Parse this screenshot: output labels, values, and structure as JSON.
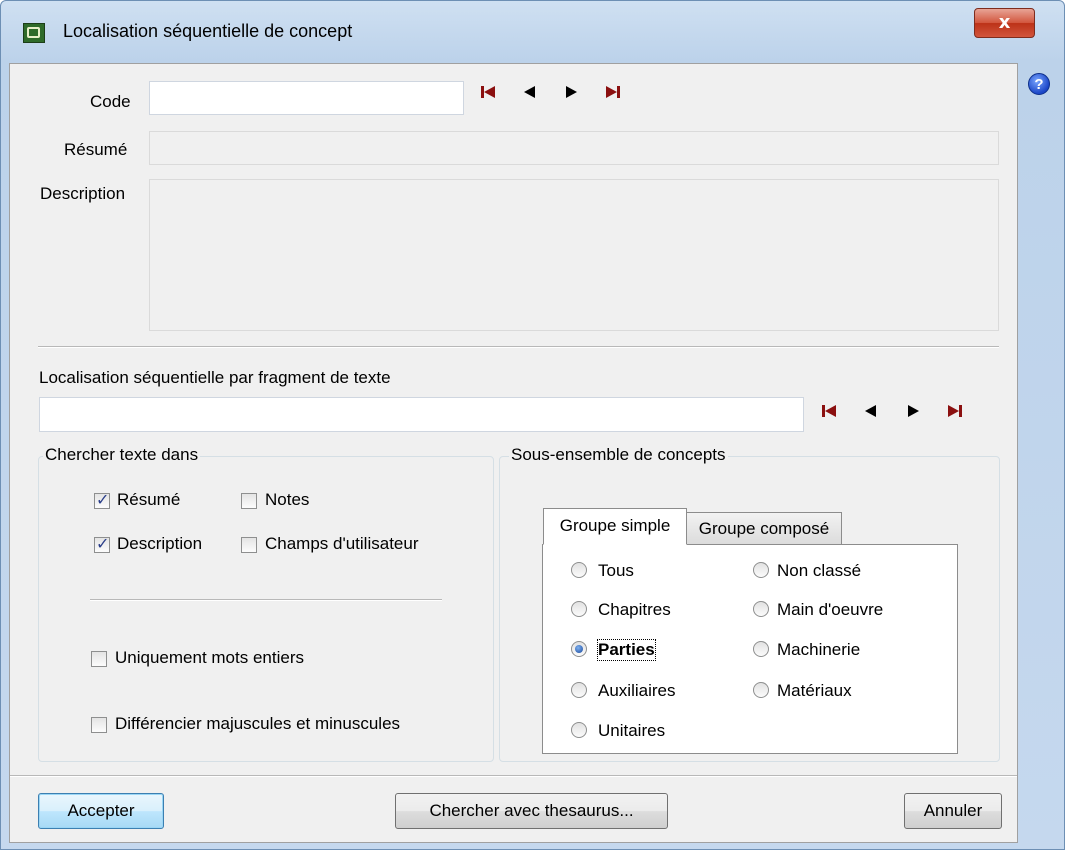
{
  "window": {
    "title": "Localisation séquentielle de concept",
    "close_label": "x",
    "help_label": "?"
  },
  "code": {
    "label": "Code",
    "value": ""
  },
  "resume": {
    "label": "Résumé",
    "value": ""
  },
  "description": {
    "label": "Description",
    "value": ""
  },
  "fragment": {
    "label": "Localisation séquentielle par fragment de texte",
    "value": ""
  },
  "search_in": {
    "title": "Chercher texte dans",
    "resume": {
      "label": "Résumé",
      "checked": true
    },
    "notes": {
      "label": "Notes",
      "checked": false
    },
    "description": {
      "label": "Description",
      "checked": true
    },
    "user_fields": {
      "label": "Champs d'utilisateur",
      "checked": false
    },
    "whole_words": {
      "label": "Uniquement mots entiers",
      "checked": false
    },
    "match_case": {
      "label": "Différencier majuscules et minuscules",
      "checked": false
    }
  },
  "subset": {
    "title": "Sous-ensemble de concepts",
    "tabs": [
      "Groupe simple",
      "Groupe composé"
    ],
    "active_tab": "Groupe simple",
    "options": {
      "tous": "Tous",
      "non_classe": "Non classé",
      "chapitres": "Chapitres",
      "main_oeuvre": "Main d'oeuvre",
      "parties": "Parties",
      "machinerie": "Machinerie",
      "auxiliaires": "Auxiliaires",
      "materiaux": "Matériaux",
      "unitaires": "Unitaires"
    },
    "selected": "Parties"
  },
  "buttons": {
    "accept": "Accepter",
    "thesaurus": "Chercher avec thesaurus...",
    "cancel": "Annuler"
  },
  "colors": {
    "nav_first_last": "#8b1010",
    "nav_prev_next": "#000000",
    "close_button": "#c94a30"
  }
}
